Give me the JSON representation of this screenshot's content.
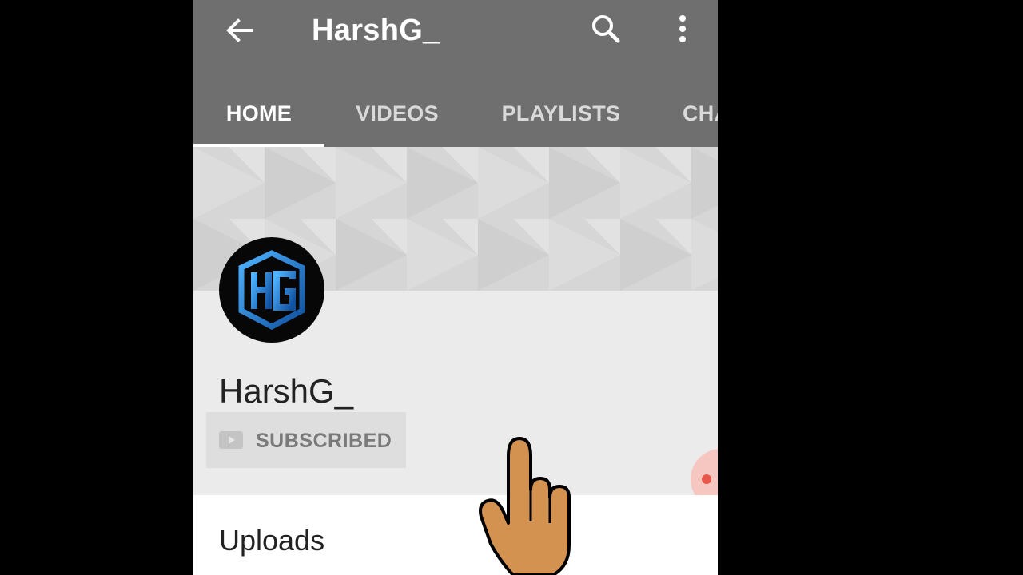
{
  "app_bar": {
    "title": "HarshG_",
    "back_icon": "arrow-back-icon",
    "search_icon": "search-icon",
    "more_icon": "more-vert-icon",
    "background_color": "#6f6f6f"
  },
  "tabs": [
    {
      "label": "HOME",
      "active": true
    },
    {
      "label": "VIDEOS",
      "active": false
    },
    {
      "label": "PLAYLISTS",
      "active": false
    },
    {
      "label": "CHA",
      "active": false
    }
  ],
  "channel": {
    "name": "HarshG_",
    "avatar_text": "HG",
    "avatar_color": "#1a73c8",
    "subscribe_label": "SUBSCRIBED",
    "subscribe_icon": "youtube-play-icon"
  },
  "uploads": {
    "title": "Uploads"
  },
  "overlay": {
    "hand_icon": "tap-hand-icon"
  }
}
